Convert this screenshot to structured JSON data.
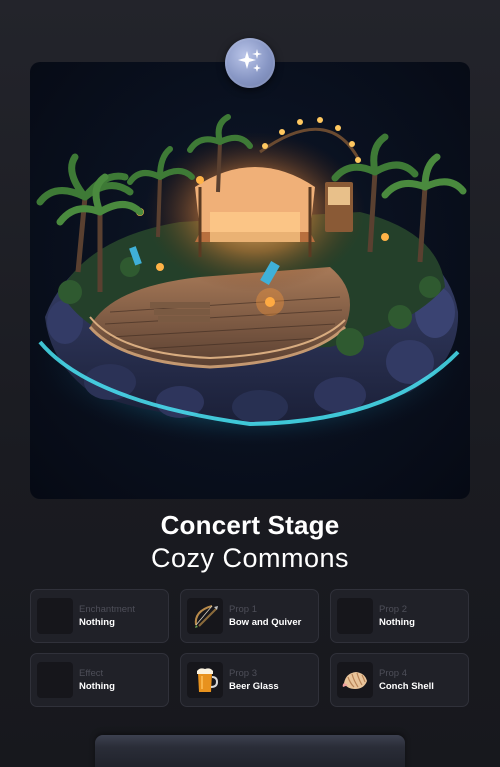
{
  "badge": {
    "icon": "sparkles-icon"
  },
  "hero": {
    "image": "island-concert-stage-illustration"
  },
  "item": {
    "title": "Concert Stage",
    "subtitle": "Cozy Commons"
  },
  "slots": [
    {
      "category": "Enchantment",
      "value": "Nothing",
      "icon": "empty-slot-icon"
    },
    {
      "category": "Prop 1",
      "value": "Bow and Quiver",
      "icon": "bow-and-quiver-icon"
    },
    {
      "category": "Prop 2",
      "value": "Nothing",
      "icon": "empty-slot-icon"
    },
    {
      "category": "Effect",
      "value": "Nothing",
      "icon": "empty-slot-icon"
    },
    {
      "category": "Prop 3",
      "value": "Beer Glass",
      "icon": "beer-glass-icon"
    },
    {
      "category": "Prop 4",
      "value": "Conch Shell",
      "icon": "conch-shell-icon"
    }
  ],
  "colors": {
    "background": "#1b1c22",
    "card": "#202128",
    "water_glow": "#36d6e6",
    "lights": "#ffb347"
  }
}
